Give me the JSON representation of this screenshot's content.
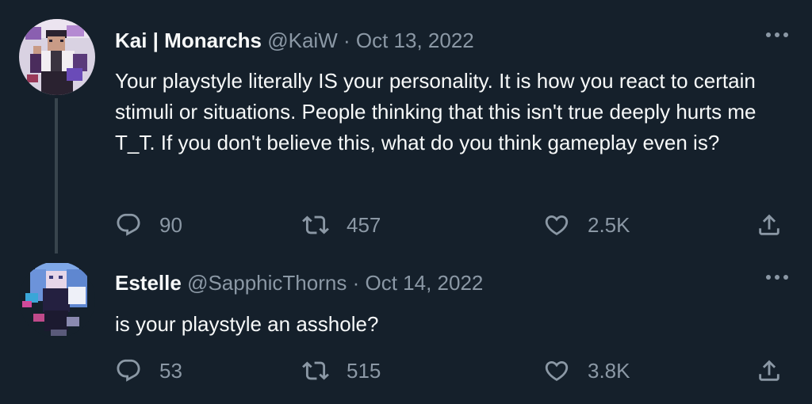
{
  "tweets": [
    {
      "display_name": "Kai | Monarchs",
      "handle": "@KaiW",
      "separator": "·",
      "date": "Oct 13, 2022",
      "text": "Your playstyle literally IS your personality. It is how you react to certain stimuli or situations. People thinking that this isn't true deeply hurts me T_T. If you don't believe this, what do you think gameplay even is?",
      "replies": "90",
      "retweets": "457",
      "likes": "2.5K",
      "avatar_icon": "pixel-art-avatar-dark-haired-character"
    },
    {
      "display_name": "Estelle",
      "handle": "@SapphicThorns",
      "separator": "·",
      "date": "Oct 14, 2022",
      "text": "is your playstyle an asshole?",
      "replies": "53",
      "retweets": "515",
      "likes": "3.8K",
      "avatar_icon": "pixel-art-avatar-blue-haired-character"
    }
  ],
  "colors": {
    "background": "#15202b",
    "text_primary": "#f7f9f9",
    "text_secondary": "#8b98a5",
    "thread_line": "#38444d"
  },
  "icons": {
    "more": "more-icon",
    "reply": "reply-icon",
    "retweet": "retweet-icon",
    "like": "like-icon",
    "share": "share-icon"
  }
}
